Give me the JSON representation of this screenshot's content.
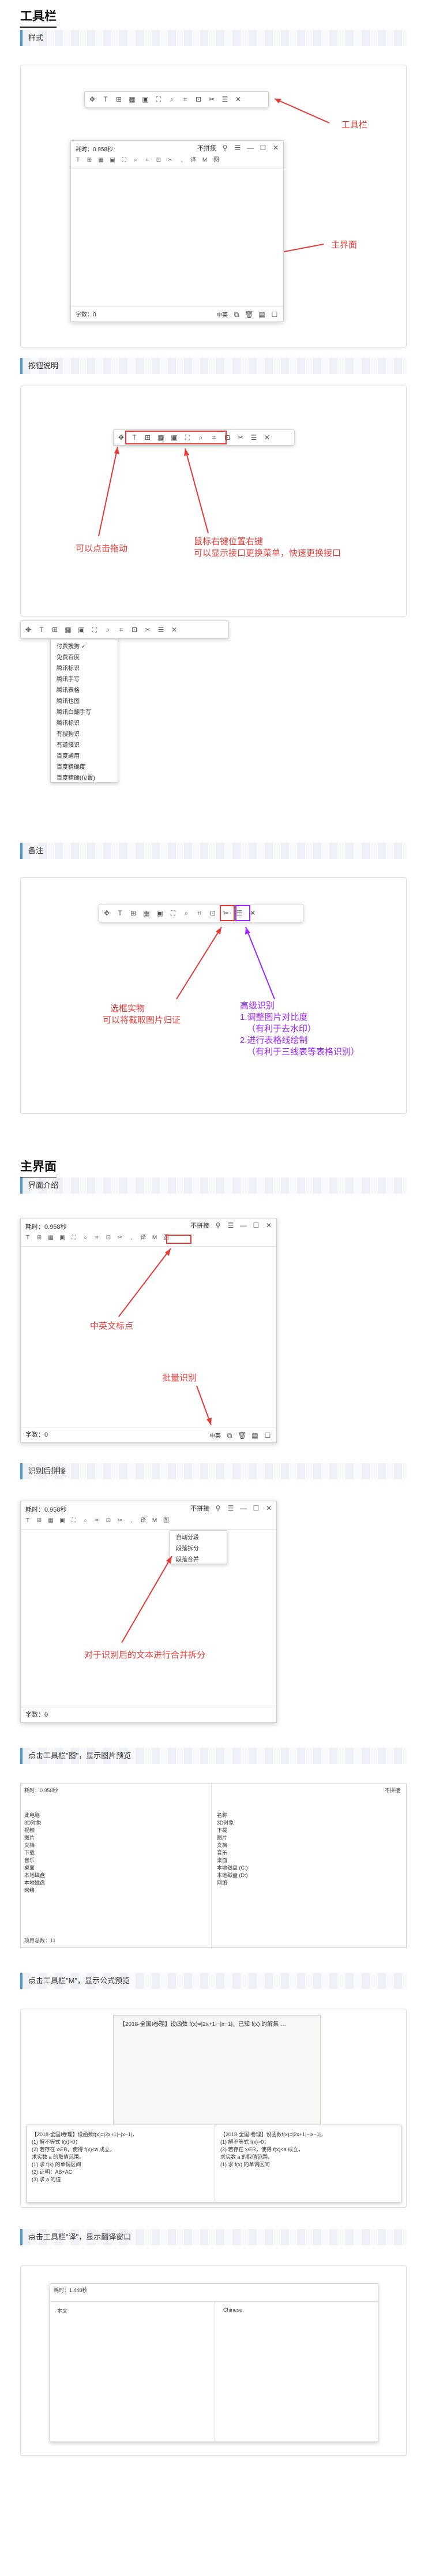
{
  "page_title": "工具栏",
  "sections": {
    "style": "样式",
    "buttons": "按钮说明",
    "notes": "备注",
    "main_intro": "界面介绍",
    "after_recog": "识别后拼接",
    "img_preview": "点击工具栏\"图\"，显示图片预览",
    "formula_preview": "点击工具栏\"M\"，显示公式预览",
    "translate": "点击工具栏\"译\"，显示翻译窗口"
  },
  "main_title": "主界面",
  "window": {
    "title": "耗时：0.958秒",
    "merge_mode": "不拼接",
    "chars_label": "字数：",
    "chars_value": "0",
    "ocr_label": "中英"
  },
  "annotations": {
    "toolbar": "工具栏",
    "main_ui": "主界面",
    "drag_hint": "可以点击拖动",
    "right_click_1": "鼠标右键位置右键",
    "right_click_2": "可以显示接口更换菜单，快速更换接口",
    "screenshot_1": "选框实物",
    "screenshot_2": "可以将截取图片归证",
    "advanced_1": "高级识别",
    "advanced_2": "1.调整图片对比度",
    "advanced_3": "（有利于去水印）",
    "advanced_4": "2.进行表格线绘制",
    "advanced_5": "（有利于三线表等表格识别）",
    "mid_punct": "中英文标点",
    "batch": "批量识别",
    "merge_split": "对于识别后的文本进行合并拆分"
  },
  "context_menu": [
    "付费搜狗 ✓",
    "免费百度",
    "腾讯标识",
    "腾讯手写",
    "腾讯表格",
    "腾讯也图",
    "腾讯白翻手写",
    "腾讯标识",
    "有搜狗识",
    "有道接识",
    "百度通用",
    "百度精确度",
    "百度精确(位置)"
  ],
  "merge_menu": [
    "自动分段",
    "段落拆分",
    "段落合并"
  ],
  "file_list": [
    "名称",
    "3D对象",
    "下载",
    "图片",
    "文档",
    "音乐",
    "桌面",
    "本地磁盘 (C:)",
    "本地磁盘 (D:)",
    "网络"
  ],
  "file_tree": [
    "此电脑",
    "3D对象",
    "视频",
    "图片",
    "文档",
    "下载",
    "音乐",
    "桌面",
    "本地磁盘",
    "本地磁盘",
    "网络"
  ],
  "file_status": "项目总数：11",
  "formula_text": "【2018·全国Ⅰ卷理】设函数 f(x)=|2x+1|−|x−1|，已知 f(x) 的解集 …",
  "formula_lines": [
    "【2018·全国Ⅰ卷理】设函数f(x)=|2x+1|−|x−1|，",
    "(1) 解不等式 f(x)>0；",
    "(2) 若存在 x∈R，使得 f(x)<a 成立，",
    "求实数 a 的取值范围。",
    "(1) 求 f(x) 的单调区间",
    "(2) 证明：AB+AC",
    "(3) 求 a 的值"
  ],
  "translate_left": "本文",
  "translate_right": "Chinese",
  "translate_time": "耗时：1.448秒"
}
